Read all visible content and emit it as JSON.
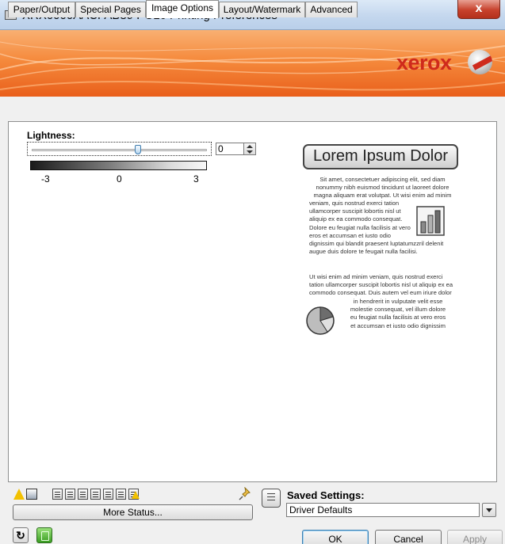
{
  "window": {
    "title": "XRX0000AACFAB89 PCL6 Printing Preferences",
    "close_symbol": "x"
  },
  "banner": {
    "brand": "xerox",
    "colors": {
      "orange": "#f58a3c",
      "brand_red": "#cf2a1c"
    }
  },
  "tabs": [
    {
      "label": "Paper/Output",
      "active": false
    },
    {
      "label": "Special Pages",
      "active": false
    },
    {
      "label": "Image Options",
      "active": true
    },
    {
      "label": "Layout/Watermark",
      "active": false
    },
    {
      "label": "Advanced",
      "active": false
    }
  ],
  "image_options": {
    "lightness_label": "Lightness:",
    "lightness_value": "0",
    "slider_min": -3,
    "slider_max": 3,
    "slider_level": 0,
    "scale_labels": [
      "-3",
      "0",
      "3"
    ]
  },
  "preview": {
    "title": "Lorem Ipsum Dolor",
    "para1": [
      "Sit amet, consectetuer adipiscing elit, sed diam",
      "nonummy nibh euismod tincidunt ut laoreet dolore",
      "magna aliquam erat volutpat. Ut wisi enim ad minim",
      "veniam, quis nostrud exerci tation",
      "ullamcorper suscipit lobortis nisl ut",
      "aliquip ex ea commodo consequat.",
      "Dolore eu feugiat nulla facilisis at vero",
      "eros et accumsan et iusto odio",
      "dignissim qui blandit praesent luptatumzzril delenit",
      "augue duis dolore te feugait nulla facilisi."
    ],
    "para2": [
      "Ut wisi enim ad minim veniam, quis nostrud exerci",
      "tation ullamcorper suscipit lobortis nisl ut aliquip ex ea",
      "commodo consequat. Duis autem vel eum iriure dolor"
    ],
    "para3": [
      "in hendrerit in vulputate velit esse",
      "molestie consequat, vel illum dolore",
      "eu feugiat nulla facilisis at vero eros",
      "et accumsan et iusto odio dignissim"
    ]
  },
  "status": {
    "more_status_label": "More Status...",
    "icons": [
      "warning-icon",
      "printer-icon",
      "tray-icon",
      "tray-icon",
      "tray-icon",
      "tray-icon",
      "tray-icon",
      "tray-icon",
      "tray-warning-icon",
      "pin-icon"
    ]
  },
  "saved_settings": {
    "label": "Saved Settings:",
    "value": "Driver Defaults"
  },
  "buttons": {
    "ok": "OK",
    "cancel": "Cancel",
    "apply": "Apply"
  },
  "footer_icons": {
    "refresh_symbol": "↻"
  }
}
